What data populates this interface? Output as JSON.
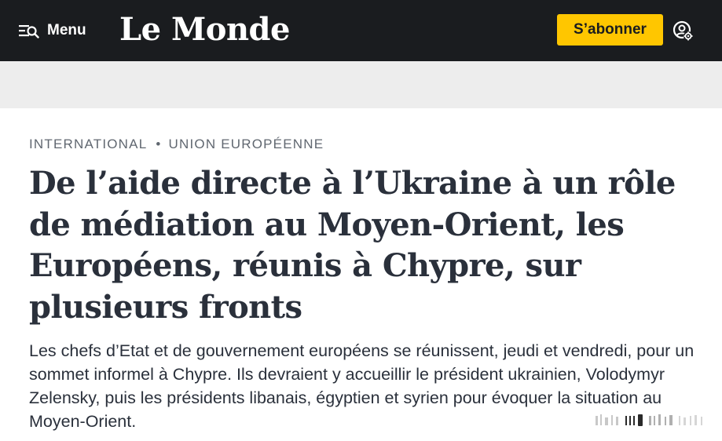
{
  "header": {
    "menu_label": "Menu",
    "logo_text": "Le Monde",
    "subscribe_label": "S’abonner",
    "menu_icon": "menu-search-icon",
    "account_icon": "account-settings-icon"
  },
  "colors": {
    "topbar_bg": "#1a1c1f",
    "subscribe_bg": "#ffc600",
    "ad_band_bg": "#ededed",
    "text": "#2a303b",
    "kicker": "#606770"
  },
  "article": {
    "kicker": {
      "section": "INTERNATIONAL",
      "separator": "•",
      "subsection": "UNION EUROPÉENNE"
    },
    "headline": "De l’aide directe à l’Ukraine à un rôle de médiation au Moyen-Orient, les Européens, réunis à Chypre, sur plusieurs fronts",
    "lede": "Les chefs d’Etat et de gouvernement européens se réunissent, jeudi et vendredi, pour un sommet informel à Chypre. Ils devraient y accueillir le président ukrainien, Volodymyr Zelensky, puis les présidents libanais, égyptien et syrien pour évoquer la situation au Moyen-Orient."
  }
}
